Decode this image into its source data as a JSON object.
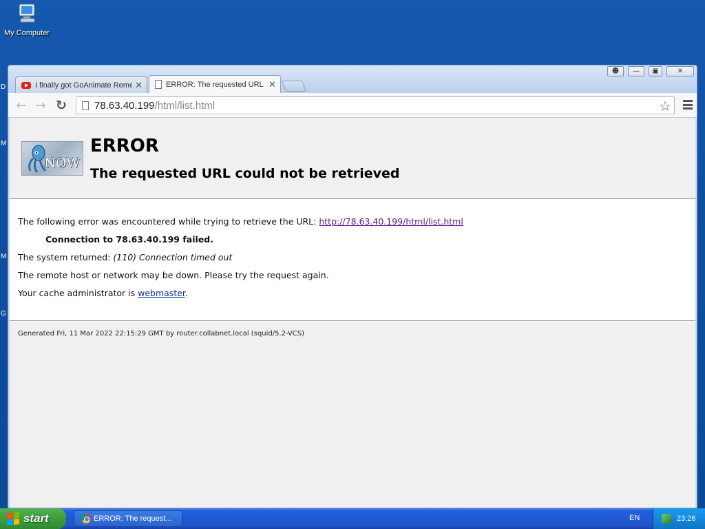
{
  "desktop": {
    "icon_label": "My Computer",
    "edge_letters": [
      "D",
      "M",
      "M",
      "G"
    ]
  },
  "browser": {
    "tabs": [
      {
        "title": "I finally got GoAnimate Reme",
        "favicon": "youtube-icon"
      },
      {
        "title": "ERROR: The requested URL",
        "favicon": "page-icon"
      }
    ],
    "url_host": "78.63.40.199",
    "url_path": "/html/list.html"
  },
  "page": {
    "title": "ERROR",
    "subtitle": "The requested URL could not be retrieved",
    "logo_text": "NOW",
    "intro_text": "The following error was encountered while trying to retrieve the URL: ",
    "url_link": "http://78.63.40.199/html/list.html",
    "connection_failed": "Connection to 78.63.40.199 failed.",
    "system_returned_label": "The system returned: ",
    "system_returned_value": "(110) Connection timed out",
    "remote_down": "The remote host or network may be down. Please try the request again.",
    "cache_admin_prefix": "Your cache administrator is ",
    "cache_admin_link": "webmaster",
    "cache_admin_suffix": ".",
    "footer": "Generated Fri, 11 Mar 2022 22:15:29 GMT by router.collabnet.local (squid/5.2-VCS)"
  },
  "taskbar": {
    "start_label": "start",
    "task_title": "ERROR: The request...",
    "language": "EN",
    "clock": "23:26"
  }
}
